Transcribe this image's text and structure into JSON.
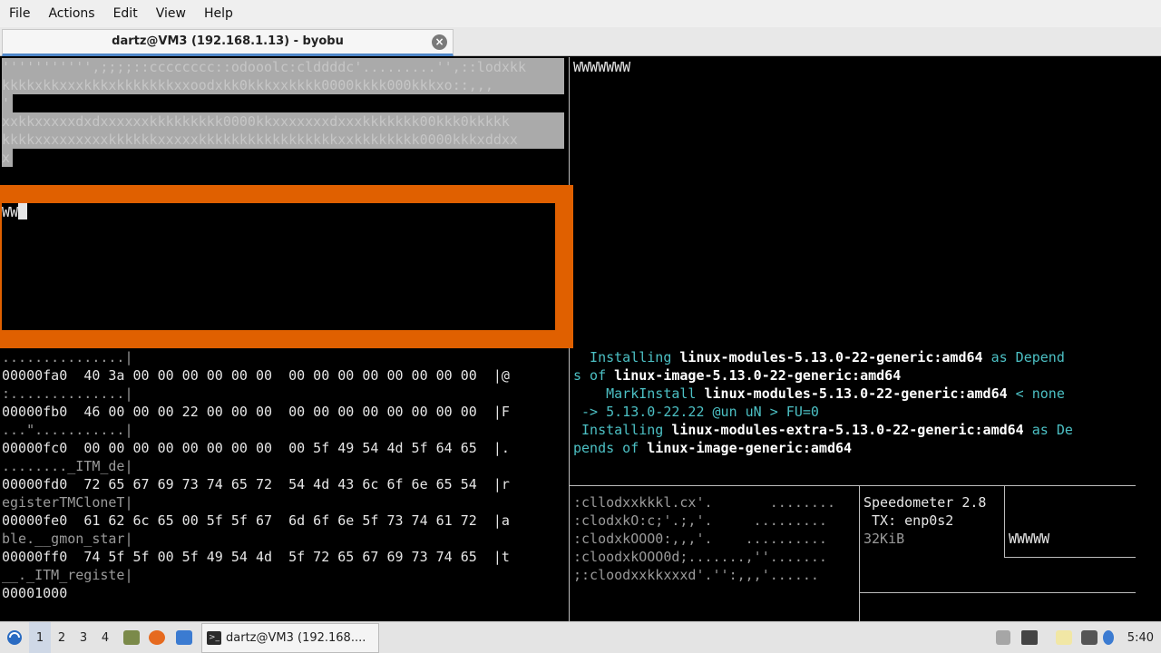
{
  "menubar": {
    "items": [
      "File",
      "Actions",
      "Edit",
      "View",
      "Help"
    ]
  },
  "tab": {
    "title": "dartz@VM3 (192.168.1.13) - byobu",
    "close": "×"
  },
  "pane_left_top": {
    "lines": [
      "''''''''''',;;;;::cccccccc::odooolc:clddddc'.........'',::lodxkk",
      "kkkkxkkxxxkkkxkkkkkkkxxoodxkk0kkkxxkkkk0000kkkk000kkkxo::,,,",
      "'",
      "xxkkxxxxxdxdxxxxxxkkkkkkkkk0000kkxxxxxxxdxxxkkkkkkk00kkk0kkkkk",
      "kkkkxxxxxxxxxkkkkkkxxxxxkkkkkkkkkkkkkkkkkxxkkkkkkkk0000kkkxddxx",
      "x"
    ],
    "prompt_text": "WW"
  },
  "pane_right_top": {
    "text": "WWWWWWW"
  },
  "hexdump": {
    "lines": [
      {
        "addr": "",
        "bytes": "",
        "ascii": "...............|"
      },
      {
        "addr": "00000fa0",
        "bytes": "40 3a 00 00 00 00 00 00  00 00 00 00 00 00 00 00",
        "ascii": "|@"
      },
      {
        "addr": "",
        "bytes": "",
        "ascii": ":..............|"
      },
      {
        "addr": "00000fb0",
        "bytes": "46 00 00 00 22 00 00 00  00 00 00 00 00 00 00 00",
        "ascii": "|F"
      },
      {
        "addr": "",
        "bytes": "",
        "ascii": "...\"...........|"
      },
      {
        "addr": "00000fc0",
        "bytes": "00 00 00 00 00 00 00 00  00 5f 49 54 4d 5f 64 65",
        "ascii": "|."
      },
      {
        "addr": "",
        "bytes": "",
        "ascii": "........_ITM_de|"
      },
      {
        "addr": "00000fd0",
        "bytes": "72 65 67 69 73 74 65 72  54 4d 43 6c 6f 6e 65 54",
        "ascii": "|r"
      },
      {
        "addr": "",
        "bytes": "",
        "ascii": "egisterTMCloneT|"
      },
      {
        "addr": "00000fe0",
        "bytes": "61 62 6c 65 00 5f 5f 67  6d 6f 6e 5f 73 74 61 72",
        "ascii": "|a"
      },
      {
        "addr": "",
        "bytes": "",
        "ascii": "ble.__gmon_star|"
      },
      {
        "addr": "00000ff0",
        "bytes": "74 5f 5f 00 5f 49 54 4d  5f 72 65 67 69 73 74 65",
        "ascii": "|t"
      },
      {
        "addr": "",
        "bytes": "",
        "ascii": "__._ITM_registe|"
      },
      {
        "addr": "00001000",
        "bytes": "",
        "ascii": ""
      }
    ]
  },
  "apt": {
    "l1a": "  Installing ",
    "l1b": "linux-modules-5.13.0-22-generic:amd64",
    "l1c": " as Depend",
    "l2a": "s of ",
    "l2b": "linux-image-5.13.0-22-generic:amd64",
    "l3a": "    MarkInstall ",
    "l3b": "linux-modules-5.13.0-22-generic:amd64",
    "l3c": " < none",
    "l4": " -> 5.13.0-22.22 @un uN > FU=0",
    "l5a": " Installing ",
    "l5b": "linux-modules-extra-5.13.0-22-generic:amd64",
    "l5c": " as De",
    "l6a": "pends of ",
    "l6b": "linux-image-generic:amd64"
  },
  "ascii_art": {
    "lines": [
      ":cllodxxkkkl.cx'.       ........",
      ":clodxkO:c;'.;,'.     .........",
      ":clodxkOOO0:,,,'.    ..........",
      ":cloodxkOOO0d;.......,''.......",
      ";:cloodxxkkxxxd'.'':,,,'......"
    ]
  },
  "speedometer": {
    "title": "Speedometer 2.8",
    "tx": " TX: enp0s2",
    "rate": "32KiB",
    "side": "WWWWW"
  },
  "taskbar": {
    "workspaces": [
      "1",
      "2",
      "3",
      "4"
    ],
    "task_label": "dartz@VM3 (192.168....",
    "task_icon": ">_",
    "clock": "5:40"
  },
  "colors": {
    "overlay_border": "#e06000",
    "accent_tab": "#4f87c9",
    "apt_text": "#4cc0c4"
  }
}
